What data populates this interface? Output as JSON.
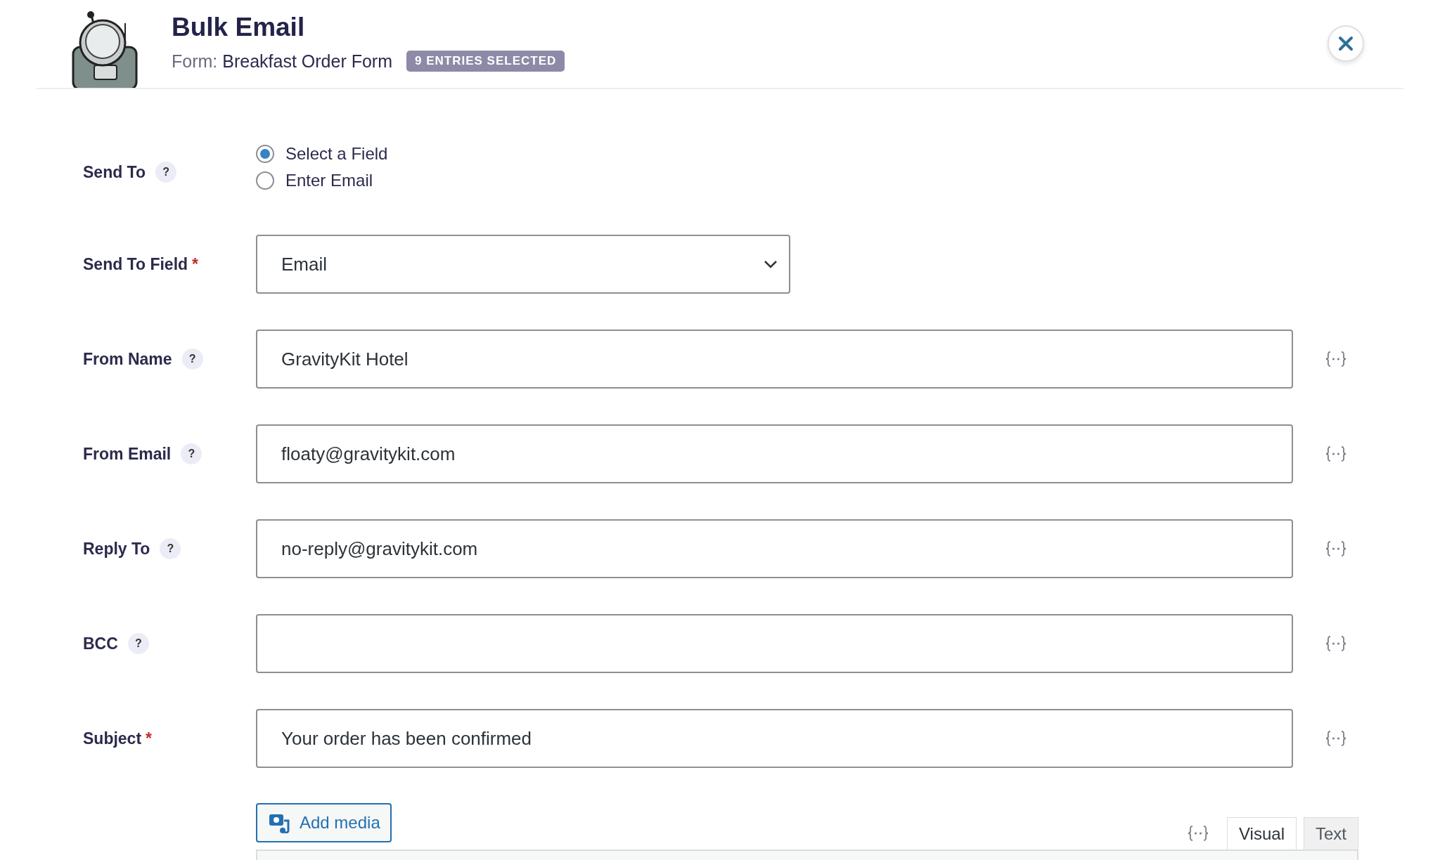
{
  "header": {
    "title": "Bulk Email",
    "form_label": "Form:",
    "form_name": "Breakfast Order Form",
    "badge": "9 ENTRIES SELECTED"
  },
  "fields": [
    {
      "kind": "radio",
      "label": "Send To",
      "help": "?",
      "options": [
        {
          "label": "Select a Field",
          "selected": true
        },
        {
          "label": "Enter Email",
          "selected": false
        }
      ]
    },
    {
      "kind": "select",
      "label": "Send To Field",
      "required_mark": "*",
      "value": "Email"
    },
    {
      "kind": "text",
      "label": "From Name",
      "help": "?",
      "merge_tags": true,
      "value": "GravityKit Hotel"
    },
    {
      "kind": "text",
      "label": "From Email",
      "help": "?",
      "merge_tags": true,
      "value": "floaty@gravitykit.com"
    },
    {
      "kind": "text",
      "label": "Reply To",
      "help": "?",
      "merge_tags": true,
      "value": "no-reply@gravitykit.com"
    },
    {
      "kind": "text",
      "label": "BCC",
      "help": "?",
      "merge_tags": true
    },
    {
      "kind": "text",
      "label": "Subject",
      "required_mark": "*",
      "merge_tags": true,
      "value": "Your order has been confirmed"
    }
  ],
  "editor": {
    "add_media": "Add media",
    "merge_tags": true,
    "tabs": [
      {
        "label": "Visual",
        "selected": true
      },
      {
        "label": "Text",
        "selected": false
      }
    ]
  }
}
